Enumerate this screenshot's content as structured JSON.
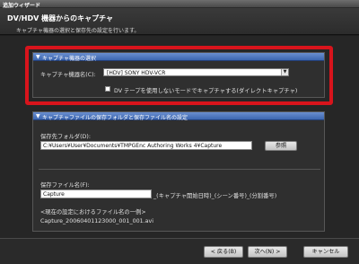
{
  "window": {
    "title": "追加ウィザード"
  },
  "header": {
    "title": "DV/HDV 機器からのキャプチャ",
    "description": "キャプチャ機器の選択と保存先の設定を行います。"
  },
  "device_panel": {
    "title": "キャプチャ機器の選択",
    "device_label": "キャプチャ機器名(C):",
    "device_value": "[HDV] SONY HDV-VCR",
    "direct_capture_label": "DV テープを使用しないモードでキャプチャする(ダイレクトキャプチャ)",
    "direct_capture_checked": false
  },
  "save_panel": {
    "title": "キャプチャファイルの保存フォルダと保存ファイル名の設定",
    "folder_label": "保存先フォルダ(D):",
    "folder_value": "C:¥Users¥User¥Documents¥TMPGEnc Authoring Works 4¥Capture",
    "browse_label": "参照",
    "filename_label": "保存ファイル名(F):",
    "filename_value": "Capture",
    "filename_suffix": "_(キャプチャ開始日時)_(シーン番号)_(分割番号)",
    "example_heading": "<現在の設定におけるファイル名の一例>",
    "example_value": "Capture_20060401123000_001_001.avi"
  },
  "footer": {
    "back_label": "< 戻る(B)",
    "next_label": "次へ(N) >",
    "cancel_label": "キャンセル"
  }
}
